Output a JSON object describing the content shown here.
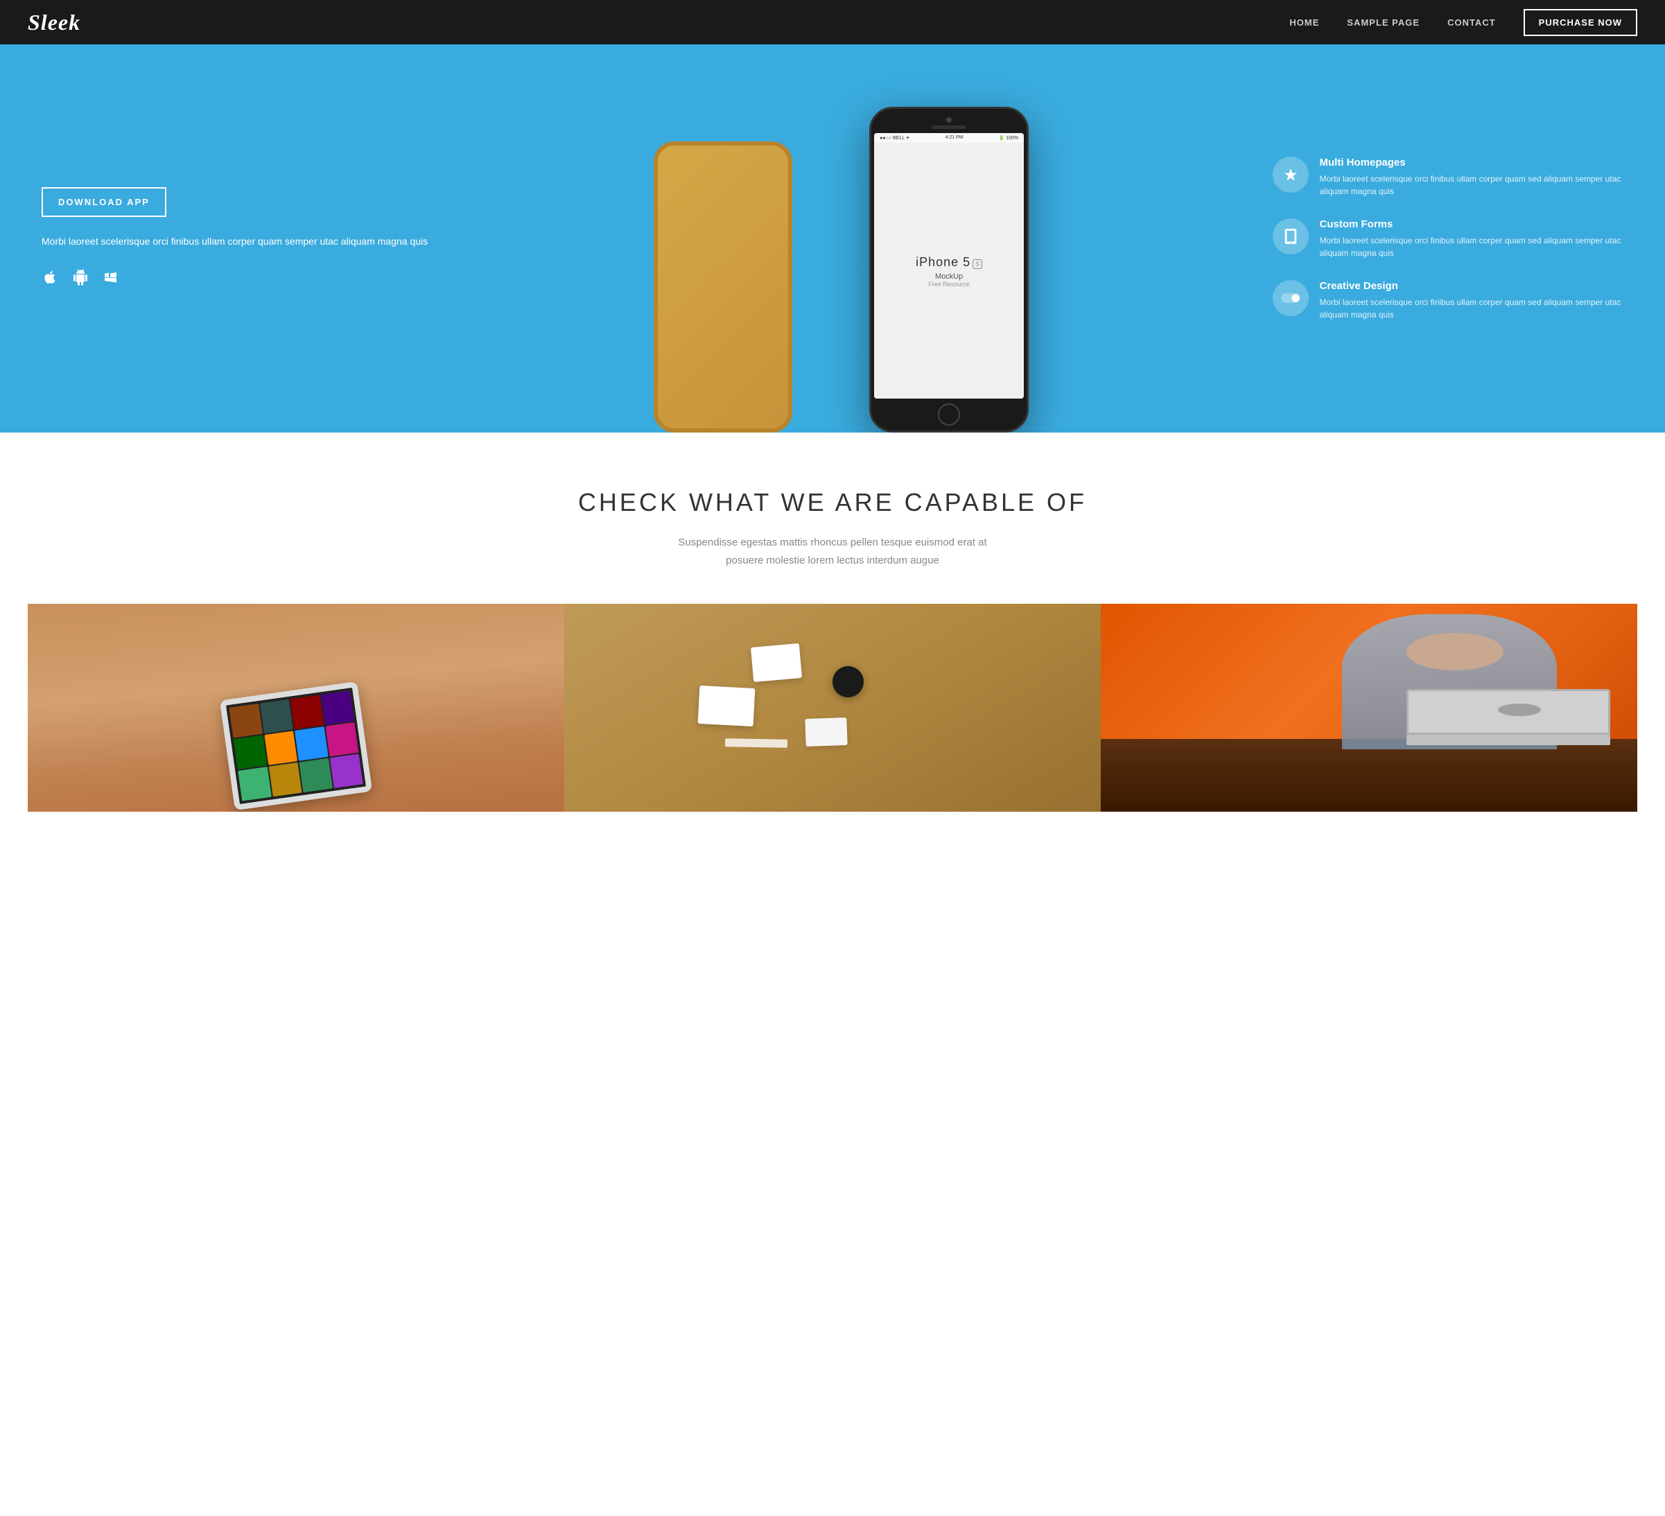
{
  "nav": {
    "logo": "Sleek",
    "links": [
      {
        "label": "HOME",
        "href": "#"
      },
      {
        "label": "SAMPLE PAGE",
        "href": "#"
      },
      {
        "label": "CONTACT",
        "href": "#"
      }
    ],
    "purchase_label": "PURCHASE NOW"
  },
  "hero": {
    "download_btn": "DOWNLOAD APP",
    "description": "Morbi laoreet scelerisque orci finibus ullam corper quam semper utac aliquam magna quis",
    "platforms": [
      "📱",
      "🤖",
      "⊞"
    ],
    "features": [
      {
        "icon": "✨",
        "title": "Multi Homepages",
        "description": "Morbi laoreet scelerisque orci finibus ullam corper quam sed aliquam semper utac aliquam magna quis"
      },
      {
        "icon": "▭",
        "title": "Custom Forms",
        "description": "Morbi laoreet scelerisque orci finibus ullam corper quam sed aliquam semper utac aliquam magna quis"
      },
      {
        "icon": "◉",
        "title": "Creative Design",
        "description": "Morbi laoreet scelerisque orci finibus ullam corper quam sed aliquam semper utac aliquam magna quis"
      }
    ],
    "phone_model": "iPhone 5",
    "phone_badge": "S",
    "phone_mockup": "MockUp",
    "phone_free": "Free Resource",
    "phone_carrier": "●●○○ BELL",
    "phone_time": "4:21 PM",
    "phone_battery": "100%"
  },
  "capabilities": {
    "title": "CHECK WHAT WE ARE CAPABLE OF",
    "description_line1": "Suspendisse egestas mattis rhoncus pellen tesque euismod erat at",
    "description_line2": "posuere molestie lorem lectus interdum augue"
  },
  "cards": [
    {
      "id": "tablet",
      "alt": "Tablet with app grid"
    },
    {
      "id": "branding",
      "alt": "Branding materials"
    },
    {
      "id": "person",
      "alt": "Person working with laptop"
    }
  ]
}
